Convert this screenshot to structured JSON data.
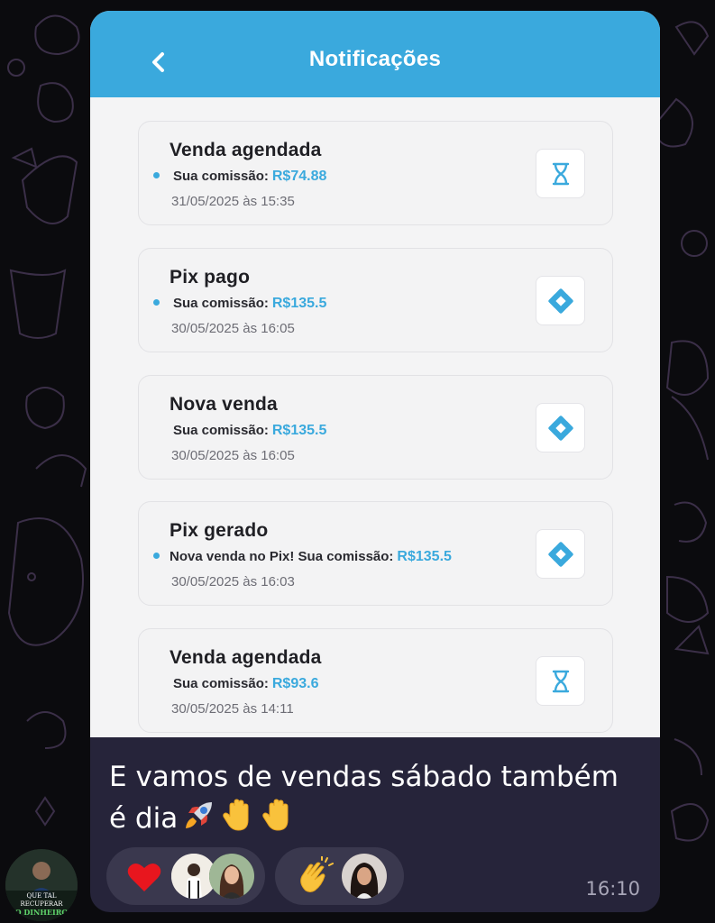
{
  "app": {
    "title": "Notificações"
  },
  "notifications": [
    {
      "title": "Venda agendada",
      "has_dot": true,
      "label": "Sua comissão:",
      "amount": "R$74.88",
      "date": "31/05/2025 às 15:35",
      "icon": "hourglass-icon"
    },
    {
      "title": "Pix pago",
      "has_dot": true,
      "label": "Sua comissão:",
      "amount": "R$135.5",
      "date": "30/05/2025 às 16:05",
      "icon": "pix-icon"
    },
    {
      "title": "Nova venda",
      "has_dot": false,
      "label": "Sua comissão:",
      "amount": "R$135.5",
      "date": "30/05/2025 às 16:05",
      "icon": "pix-icon"
    },
    {
      "title": "Pix gerado",
      "has_dot": true,
      "label": "Nova venda no Pix! Sua comissão:",
      "amount": "R$135.5",
      "date": "30/05/2025 às 16:03",
      "icon": "pix-icon"
    },
    {
      "title": "Venda agendada",
      "has_dot": false,
      "label": "Sua comissão:",
      "amount": "R$93.6",
      "date": "30/05/2025 às 14:11",
      "icon": "hourglass-icon"
    }
  ],
  "message": {
    "text_line1": "E vamos de vendas sábado também",
    "text_line2": "é dia",
    "emojis": [
      "rocket-emoji",
      "raised-hand-emoji",
      "raised-hand-emoji"
    ],
    "time": "16:10"
  },
  "reactions": [
    {
      "emoji": "red-heart-emoji",
      "reactors": 2
    },
    {
      "emoji": "clapping-hands-emoji",
      "reactors": 1
    }
  ],
  "sender_avatar": {
    "lines": [
      "QUE TAL",
      "RECUPERAR",
      "O DINHEIRO"
    ]
  },
  "colors": {
    "accent": "#3aa9dd",
    "bubble": "#26243a",
    "chat_background": "#0b0b0e"
  }
}
